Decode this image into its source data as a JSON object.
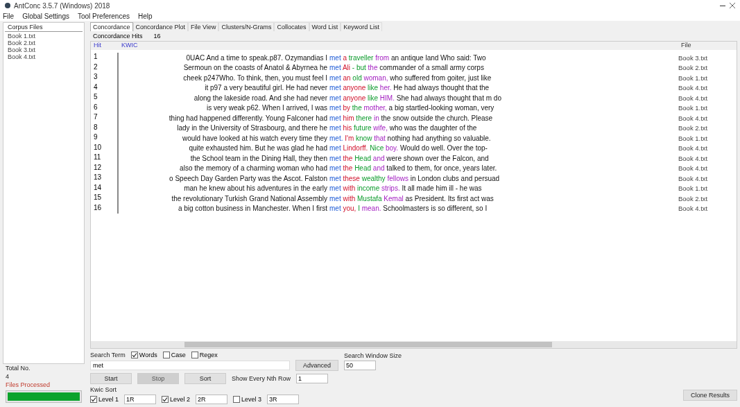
{
  "window": {
    "title": "AntConc 3.5.7 (Windows) 2018"
  },
  "menu": [
    "File",
    "Global Settings",
    "Tool Preferences",
    "Help"
  ],
  "corpus": {
    "title": "Corpus Files",
    "files": [
      {
        "name": "Book 1.txt",
        "selected": false
      },
      {
        "name": "Book 2.txt",
        "selected": false
      },
      {
        "name": "Book 3.txt",
        "selected": false
      },
      {
        "name": "Book 4.txt",
        "selected": false
      }
    ],
    "total_label": "Total No.",
    "total": "4",
    "processed_label": "Files Processed",
    "progress": {
      "level": 1
    }
  },
  "tabs": [
    {
      "label": "Concordance",
      "selected": true
    },
    {
      "label": "Concordance Plot",
      "selected": false
    },
    {
      "label": "File View",
      "selected": false
    },
    {
      "label": "Clusters/N-Grams",
      "selected": false
    },
    {
      "label": "Collocates",
      "selected": false
    },
    {
      "label": "Word List",
      "selected": false
    },
    {
      "label": "Keyword List",
      "selected": false
    }
  ],
  "hits_label": "Concordance Hits",
  "hits": "16",
  "columns": [
    "Hit",
    "KWIC",
    "File"
  ],
  "rows": [
    {
      "hit": "1",
      "left": "0UAC And a time to speak.p87. Ozymandias I",
      "kw": "met",
      "right": [
        "a",
        "traveller",
        "from",
        "an antique land Who said: Two"
      ],
      "file": "Book 3.txt"
    },
    {
      "hit": "2",
      "left": "Sermoun on the coasts of Anatol & Abyrnea he",
      "kw": "met",
      "right": [
        "Ali",
        "- but",
        "the",
        "commander of a small army corps"
      ],
      "file": "Book 2.txt"
    },
    {
      "hit": "3",
      "left": "cheek p247Who. To think, then, you must feel I",
      "kw": "met",
      "right": [
        "an",
        "old",
        "woman,",
        "who suffered from goiter, just like"
      ],
      "file": "Book 1.txt"
    },
    {
      "hit": "4",
      "left": "it p97 a very beautiful girl. He had never",
      "kw": "met",
      "right": [
        "anyone",
        "like",
        "her.",
        "He had always thought that the"
      ],
      "file": "Book 4.txt"
    },
    {
      "hit": "5",
      "left": "along the lakeside road. And she had never",
      "kw": "met",
      "right": [
        "anyone",
        "like",
        "HIM.",
        "She had always thought that m do"
      ],
      "file": "Book 4.txt"
    },
    {
      "hit": "6",
      "left": "is very weak p62. When I arrived, I was",
      "kw": "met",
      "right": [
        "by",
        "the",
        "mother,",
        "a big startled-looking woman, very"
      ],
      "file": "Book 1.txt"
    },
    {
      "hit": "7",
      "left": "thing had happened differently. Young Falconer had",
      "kw": "met",
      "right": [
        "him",
        "there",
        "in",
        "the snow outside the church. Please"
      ],
      "file": "Book 4.txt"
    },
    {
      "hit": "8",
      "left": "lady in the University of Strasbourg, and there he",
      "kw": "met",
      "right": [
        "his",
        "future",
        "wife,",
        "who was the daughter of the"
      ],
      "file": "Book 2.txt"
    },
    {
      "hit": "9",
      "left": "would have looked at his watch every time they",
      "kw": "met.",
      "right": [
        "I'm",
        "know",
        "that",
        "nothing had anything so valuable."
      ],
      "file": "Book 1.txt"
    },
    {
      "hit": "10",
      "left": "quite exhausted him. But he was glad he had",
      "kw": "met",
      "right": [
        "Lindorff.",
        "Nice",
        "boy.",
        "Would do well. Over the top-"
      ],
      "file": "Book 4.txt"
    },
    {
      "hit": "11",
      "left": "the School team in the Dining Hall, they then",
      "kw": "met",
      "right": [
        "the",
        "Head",
        "and",
        "were shown over the Falcon, and"
      ],
      "file": "Book 4.txt"
    },
    {
      "hit": "12",
      "left": "also the memory of a charming woman who had",
      "kw": "met",
      "right": [
        "the",
        "Head",
        "and",
        "talked to them, for once, years later."
      ],
      "file": "Book 4.txt"
    },
    {
      "hit": "13",
      "left": "o Speech Day Garden Party was the Ascot. Falston",
      "kw": "met",
      "right": [
        "these",
        "wealthy",
        "fellows",
        "in London clubs and persuad"
      ],
      "file": "Book 4.txt"
    },
    {
      "hit": "14",
      "left": "man he knew about his adventures in the early",
      "kw": "met",
      "right": [
        "with",
        "income",
        "strips.",
        "It all made him ill - he was"
      ],
      "file": "Book 1.txt"
    },
    {
      "hit": "15",
      "left": "the revolutionary Turkish Grand National Assembly",
      "kw": "met",
      "right": [
        "with",
        "Mustafa",
        "Kemal",
        "as President. Its first act was"
      ],
      "file": "Book 2.txt"
    },
    {
      "hit": "16",
      "left": "a big cotton business in Manchester. When I first",
      "kw": "met",
      "right": [
        "you,",
        "I",
        "mean.",
        "Schoolmasters is so different, so I"
      ],
      "file": "Book 4.txt"
    }
  ],
  "search": {
    "label": "Search Term",
    "options": [
      {
        "label": "Words",
        "checked": true
      },
      {
        "label": "Case",
        "checked": false
      },
      {
        "label": "Regex",
        "checked": false
      }
    ],
    "value": "met",
    "advanced": "Advanced",
    "window_label": "Search Window Size",
    "window_size": "50"
  },
  "buttons": [
    {
      "label": "Start",
      "disabled": false
    },
    {
      "label": "Stop",
      "disabled": true
    },
    {
      "label": "Sort",
      "disabled": false
    }
  ],
  "nth_label": "Show Every Nth Row",
  "nth_value": "1",
  "kwic_sort": {
    "label": "Kwic Sort",
    "levels": [
      {
        "label": "Level 1",
        "checked": true,
        "value": "1R"
      },
      {
        "label": "Level 2",
        "checked": true,
        "value": "2R"
      },
      {
        "label": "Level 3",
        "checked": false,
        "value": "3R"
      }
    ]
  },
  "clone": "Clone Results"
}
